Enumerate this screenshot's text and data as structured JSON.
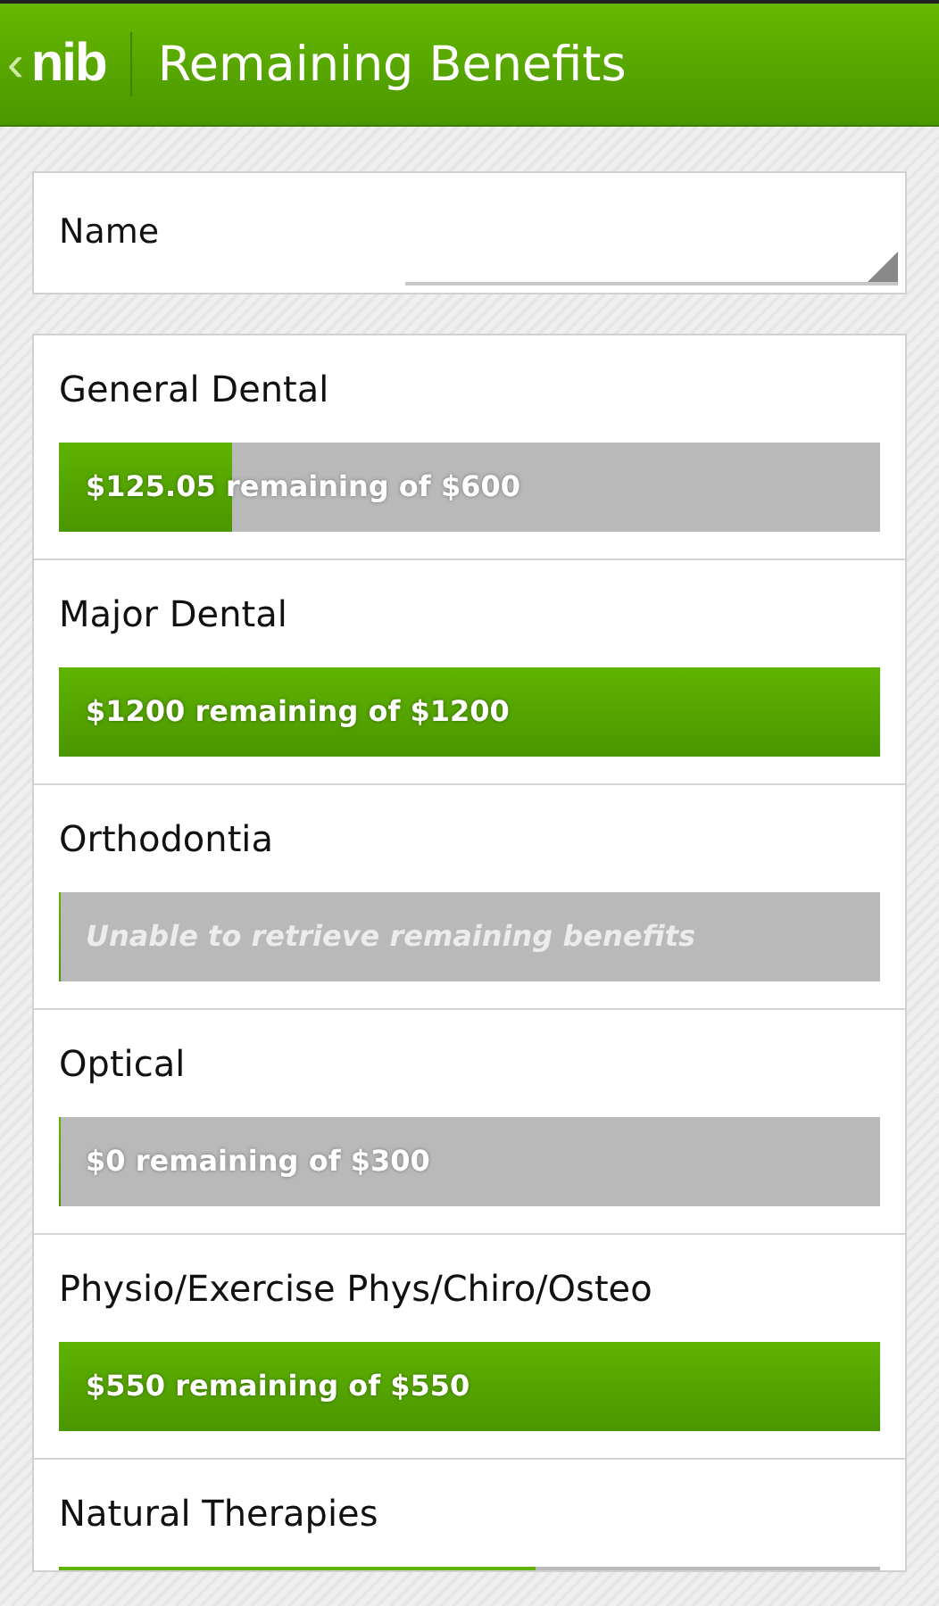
{
  "header": {
    "back": "‹",
    "logo": "nib",
    "title": "Remaining Benefits"
  },
  "name_field": {
    "label": "Name"
  },
  "benefits": [
    {
      "name": "General Dental",
      "kind": "amount",
      "level": 0.21,
      "text": "$125.05 remaining of $600"
    },
    {
      "name": "Major Dental",
      "kind": "amount",
      "level": 1,
      "text": "$1200 remaining of $1200"
    },
    {
      "name": "Orthodontia",
      "kind": "unavailable",
      "level": 0,
      "text": "Unable to retrieve remaining benefits"
    },
    {
      "name": "Optical",
      "kind": "amount",
      "level": 0,
      "text": "$0 remaining of $300"
    },
    {
      "name": "Physio/Exercise Phys/Chiro/Osteo",
      "kind": "amount",
      "level": 1,
      "text": "$550 remaining of $550"
    },
    {
      "name": "Natural Therapies",
      "kind": "amount",
      "level": 0.58
    }
  ]
}
